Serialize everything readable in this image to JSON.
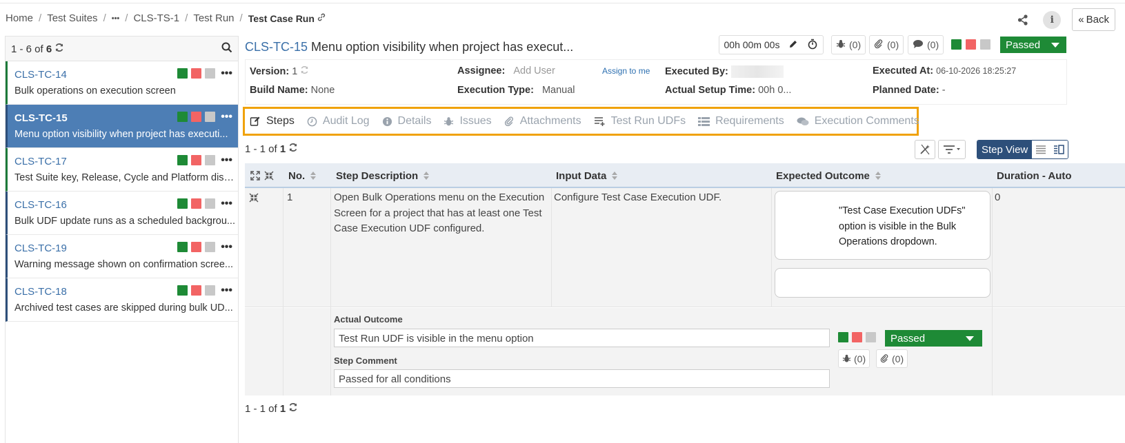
{
  "breadcrumb": {
    "items": [
      "Home",
      "Test Suites",
      "•••",
      "CLS-TS-1",
      "Test Run"
    ],
    "current": "Test Case Run"
  },
  "header": {
    "back_label": "Back"
  },
  "left_panel": {
    "range": "1 - 6 of",
    "total": "6",
    "items": [
      {
        "key": "CLS-TC-14",
        "title": "Bulk operations on execution screen"
      },
      {
        "key": "CLS-TC-15",
        "title": "Menu option visibility when project has executi..."
      },
      {
        "key": "CLS-TC-17",
        "title": "Test Suite key, Release, Cycle and Platform displ..."
      },
      {
        "key": "CLS-TC-16",
        "title": "Bulk UDF update runs as a scheduled backgrou..."
      },
      {
        "key": "CLS-TC-19",
        "title": "Warning message shown on confirmation scree..."
      },
      {
        "key": "CLS-TC-18",
        "title": "Archived test cases are skipped during bulk UD..."
      }
    ]
  },
  "testcase": {
    "key": "CLS-TC-15",
    "title": "Menu option visibility when project has execut...",
    "timer": "00h 00m 00s",
    "issues_count": "(0)",
    "attachments_count": "(0)",
    "comments_count": "(0)",
    "status": "Passed"
  },
  "info": {
    "version_label": "Version:",
    "version_value": "1",
    "assignee_label": "Assignee:",
    "assignee_value": "Add User",
    "assign_me": "Assign to me",
    "executed_by_label": "Executed By:",
    "executed_at_label": "Executed At:",
    "executed_at_value": "06-10-2026 18:25:27",
    "build_label": "Build Name:",
    "build_value": "None",
    "exec_type_label": "Execution Type:",
    "exec_type_value": "Manual",
    "setup_label": "Actual Setup Time:",
    "setup_value": "00h 0...",
    "planned_label": "Planned Date:",
    "planned_value": "-"
  },
  "tabs": [
    "Steps",
    "Audit Log",
    "Details",
    "Issues",
    "Attachments",
    "Test Run UDFs",
    "Requirements",
    "Execution Comments"
  ],
  "steps": {
    "range": "1 - 1 of",
    "total": "1",
    "view_label": "Step View",
    "columns": [
      "No.",
      "Step Description",
      "Input Data",
      "Expected Outcome",
      "Duration - Auto"
    ],
    "row": {
      "no": "1",
      "description": "Open Bulk Operations menu on the Execution Screen for a project that has at least one Test Case Execution UDF configured.",
      "input_data": "Configure Test Case Execution UDF.",
      "expected": "\"Test Case Execution UDFs\" option is visible in the Bulk Operations dropdown.",
      "duration": "0",
      "actual_outcome_label": "Actual Outcome",
      "actual_outcome_value": "Test Run UDF is visible in the menu option",
      "step_comment_label": "Step Comment",
      "step_comment_value": "Passed for all conditions",
      "status": "Passed",
      "issues_count": "(0)",
      "attachments_count": "(0)"
    }
  },
  "colors": {
    "pass": "#1e8a36",
    "fail": "#f26464",
    "not_run": "#c8c8c8",
    "link": "#3a6fa8",
    "selected": "#4d7eb5",
    "highlight": "#f0a20a"
  }
}
